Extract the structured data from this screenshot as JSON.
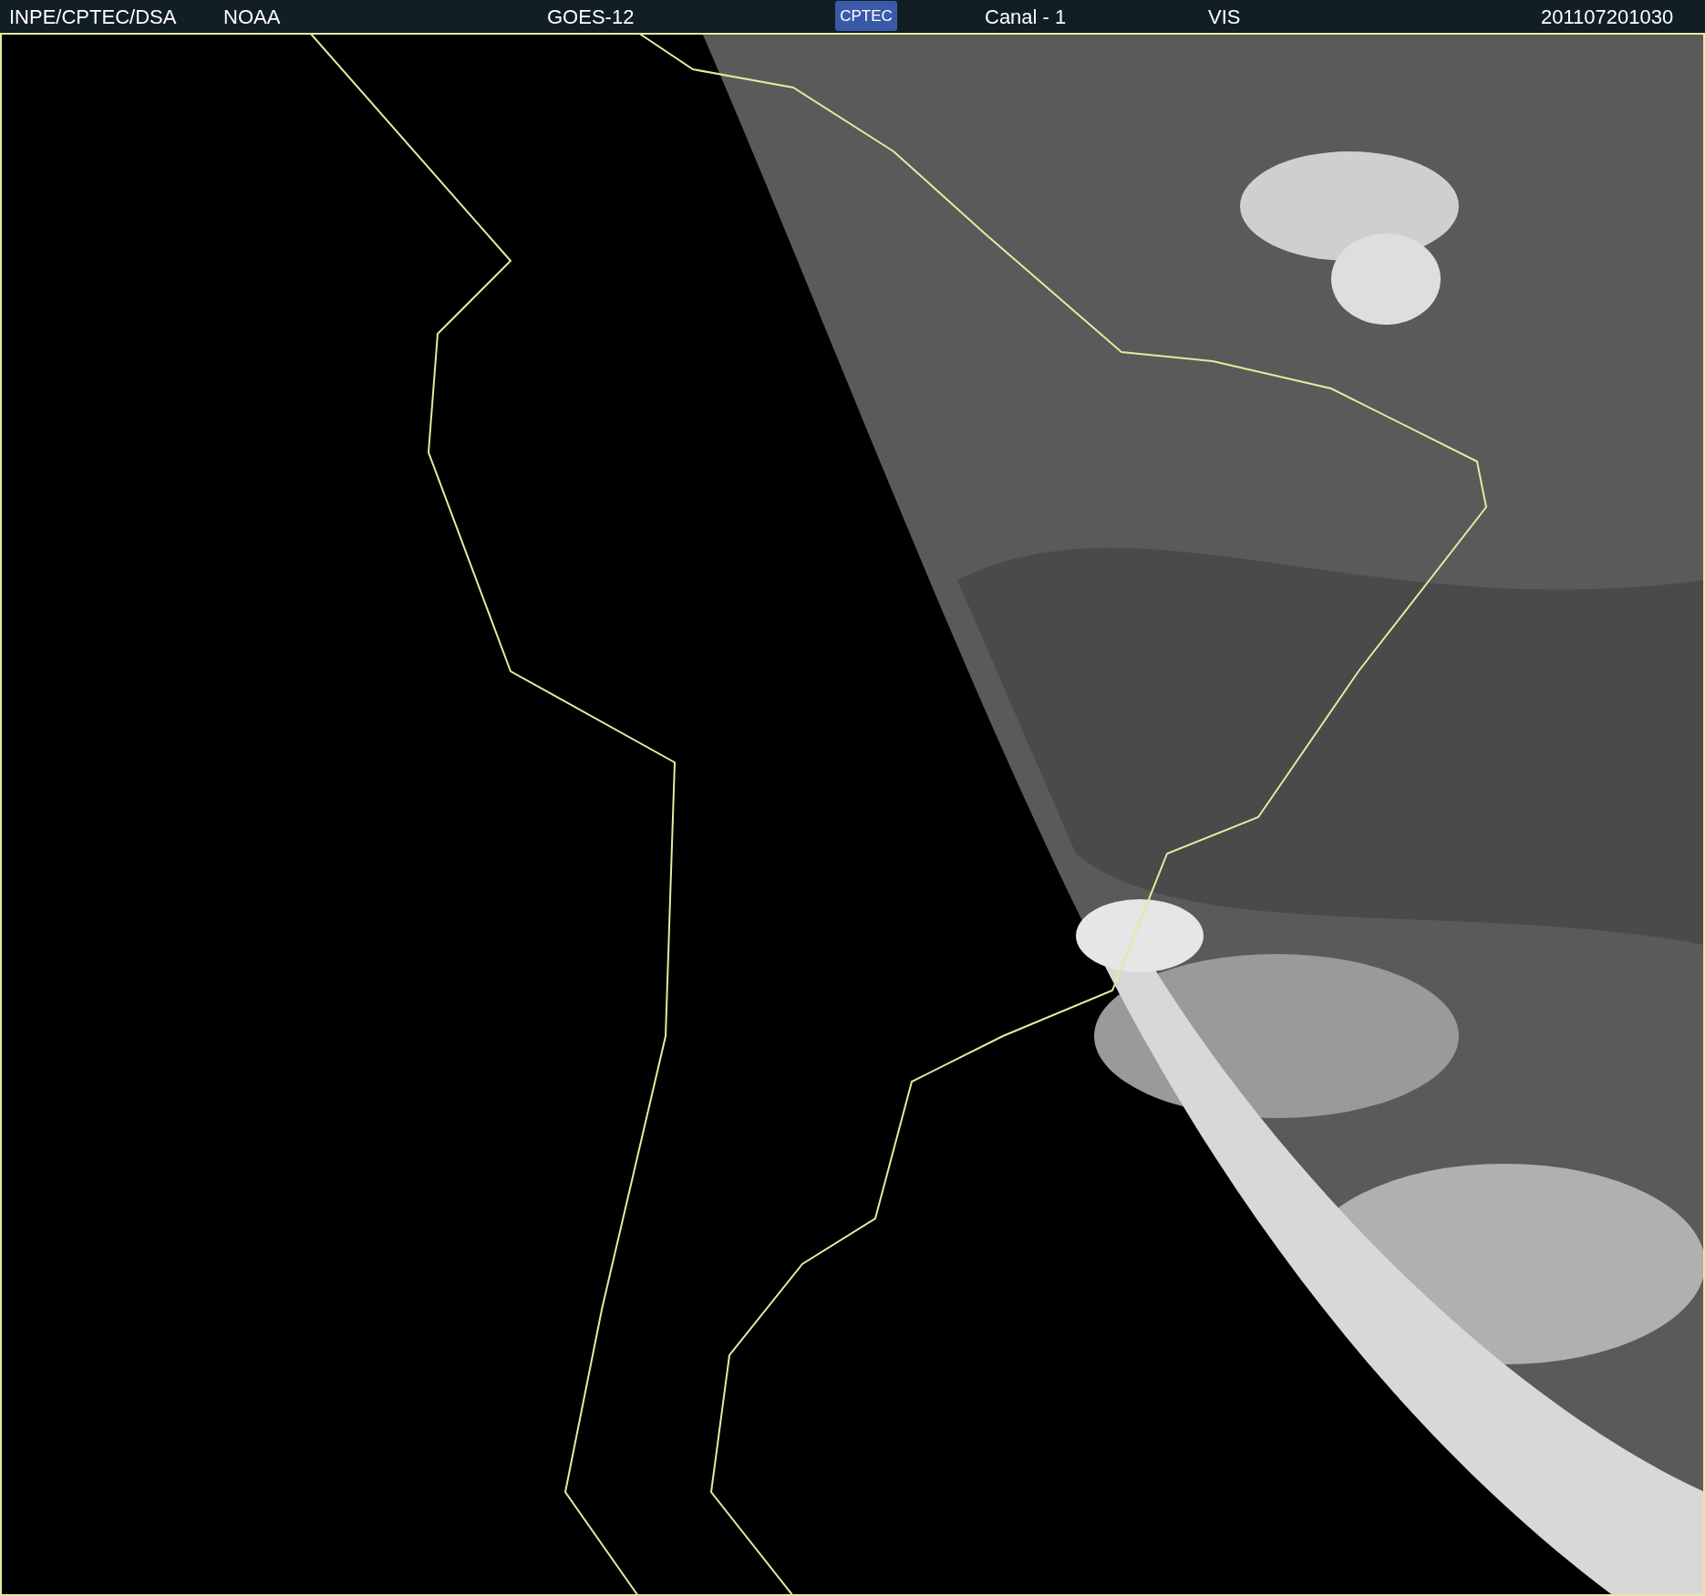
{
  "header": {
    "source": "INPE/CPTEC/DSA",
    "agency": "NOAA",
    "satellite": "GOES-12",
    "logo": "CPTEC",
    "channel": "Canal - 1",
    "band": "VIS",
    "timestamp": "201107201030"
  }
}
